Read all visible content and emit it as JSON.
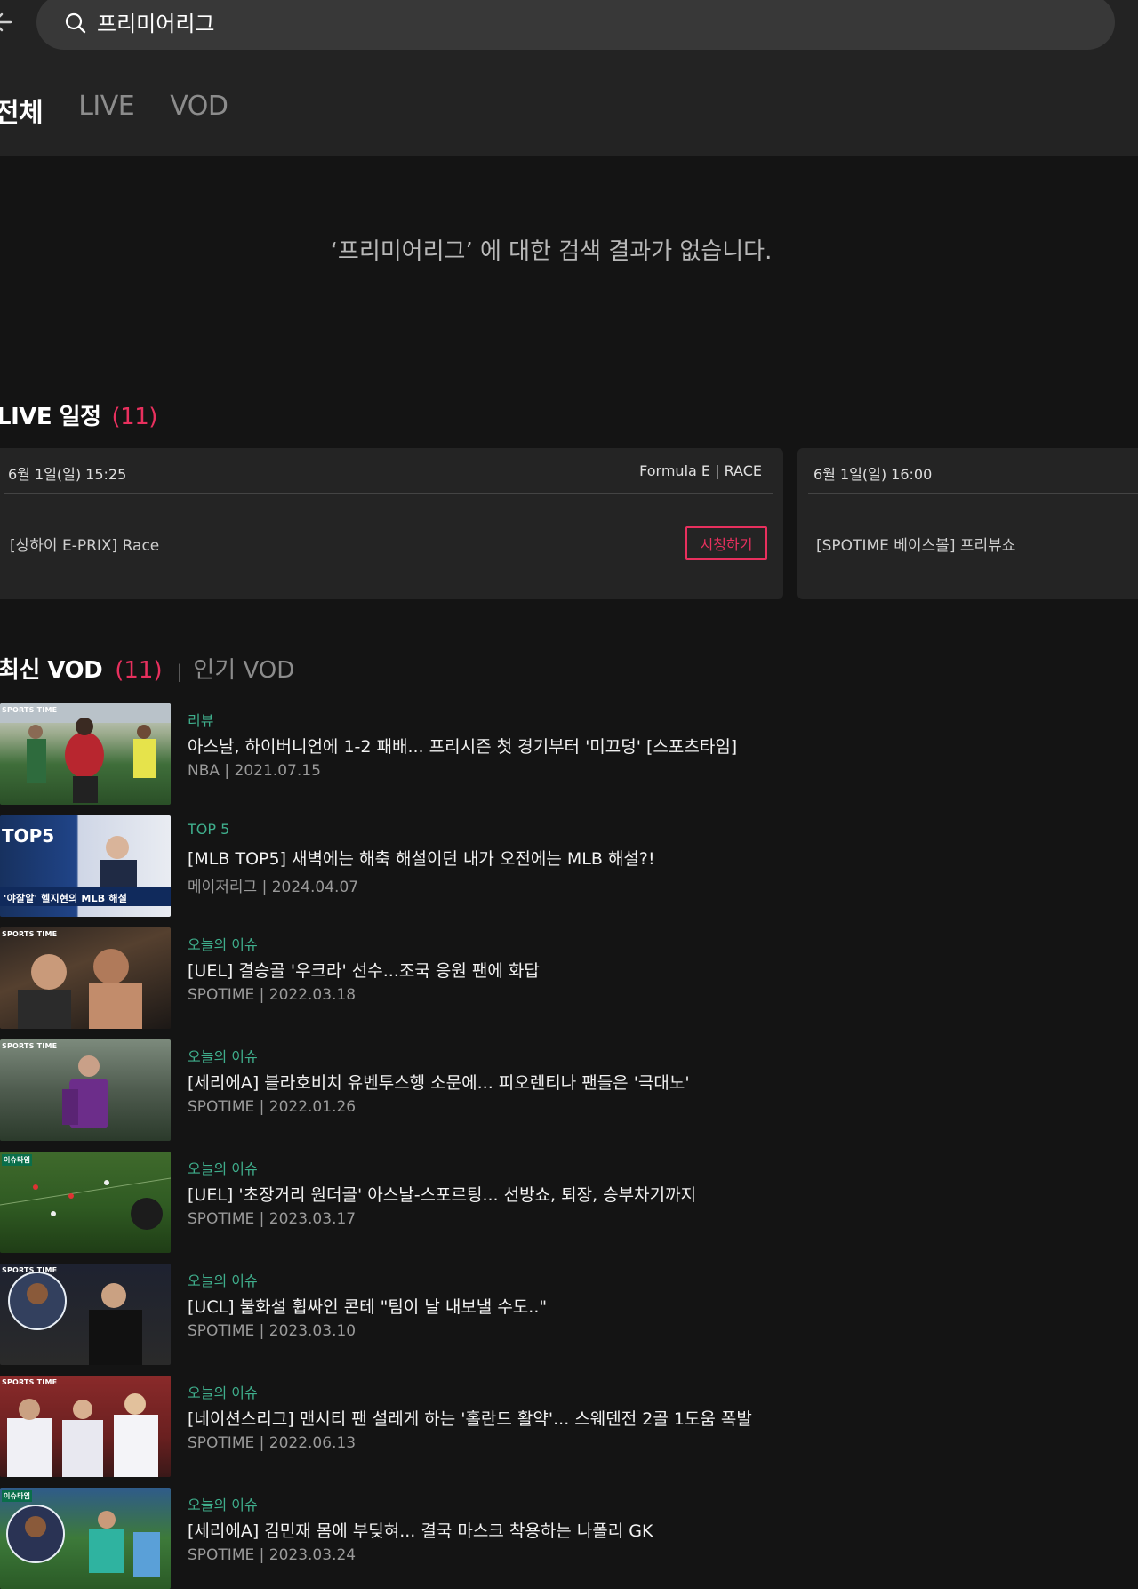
{
  "header": {
    "search_value": "프리미어리그",
    "tabs": [
      {
        "label": "전체"
      },
      {
        "label": "LIVE"
      },
      {
        "label": "VOD"
      }
    ]
  },
  "empty_message": "‘프리미어리그’ 에 대한 검색 결과가 없습니다.",
  "live": {
    "title": "LIVE 일정",
    "count": "(11)",
    "cards": [
      {
        "date": "6월 1일(일) 15:25",
        "category": "Formula E | RACE",
        "name": "[상하이 E-PRIX] Race",
        "button": "시청하기"
      },
      {
        "date": "6월 1일(일) 16:00",
        "category": "",
        "name": "[SPOTIME 베이스볼] 프리뷰쇼",
        "button": ""
      }
    ]
  },
  "vod": {
    "title": "최신 VOD",
    "count": "(11)",
    "sep": "|",
    "alt_tab": "인기 VOD",
    "items": [
      {
        "category": "리뷰",
        "title": "아스날, 하이버니언에 1-2 패배... 프리시즌 첫 경기부터 '미끄덩' [스포츠타임]",
        "meta": "NBA | 2021.07.15",
        "thumb_label": "SPORTS TIME"
      },
      {
        "category": "TOP 5",
        "title": "[MLB TOP5] 새벽에는 해축 해설이던 내가 오전에는 MLB 해설?!",
        "meta": "메이저리그 | 2024.04.07",
        "thumb_label": "'야잘알' 헬지현의 MLB 해설"
      },
      {
        "category": "오늘의 이슈",
        "title": "[UEL] 결승골 '우크라' 선수...조국 응원 팬에 화답",
        "meta": "SPOTIME | 2022.03.18",
        "thumb_label": "SPORTS TIME"
      },
      {
        "category": "오늘의 이슈",
        "title": "[세리에A] 블라호비치 유벤투스행 소문에... 피오렌티나 팬들은 '극대노'",
        "meta": "SPOTIME | 2022.01.26",
        "thumb_label": "SPORTS TIME"
      },
      {
        "category": "오늘의 이슈",
        "title": "[UEL] '초장거리 원더골' 아스날-스포르팅... 선방쇼, 퇴장, 승부차기까지",
        "meta": "SPOTIME | 2023.03.17",
        "thumb_label": "이슈타임"
      },
      {
        "category": "오늘의 이슈",
        "title": "[UCL] 불화설 휩싸인 콘테 \"팀이 날 내보낼 수도..\"",
        "meta": "SPOTIME | 2023.03.10",
        "thumb_label": "SPORTS TIME"
      },
      {
        "category": "오늘의 이슈",
        "title": "[네이션스리그]  맨시티 팬 설레게 하는 '홀란드 활약'... 스웨덴전 2골 1도움 폭발",
        "meta": "SPOTIME | 2022.06.13",
        "thumb_label": "SPORTS TIME"
      },
      {
        "category": "오늘의 이슈",
        "title": "[세리에A] 김민재 몸에 부딪혀... 결국 마스크 착용하는 나폴리 GK",
        "meta": "SPOTIME | 2023.03.24",
        "thumb_label": "이슈타임"
      }
    ]
  },
  "colors": {
    "accent": "#e8305e",
    "category": "#3fae8c",
    "background": "#141414",
    "header_bg": "#232323"
  }
}
